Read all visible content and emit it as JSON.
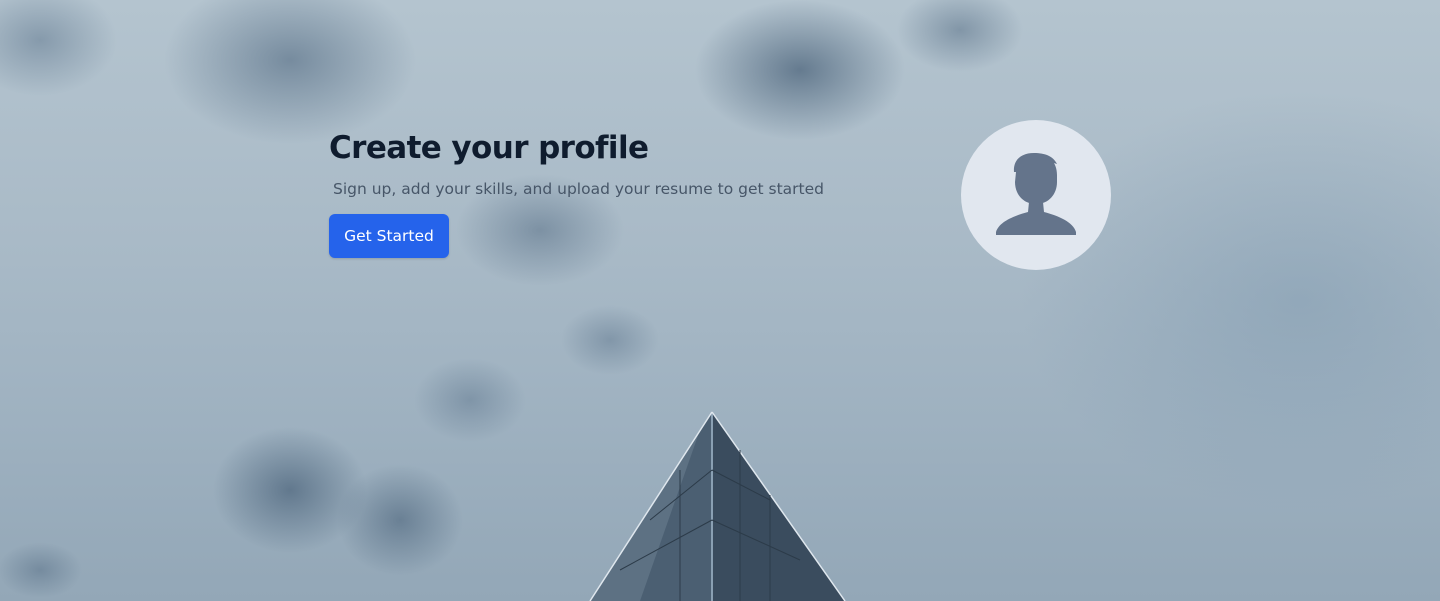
{
  "hero": {
    "background_image": "cloudy-sky-with-building-top",
    "title": "Create your profile",
    "subtitle": "Sign up, add your skills, and upload your resume to get started",
    "cta_label": "Get Started"
  },
  "avatar": {
    "icon": "user-silhouette-icon"
  },
  "colors": {
    "title": "#0f1c2e",
    "subtitle": "#475668",
    "button_bg": "#2563eb",
    "button_text": "#ffffff",
    "avatar_bg": "#e1e7ef",
    "avatar_icon": "#64748b"
  }
}
